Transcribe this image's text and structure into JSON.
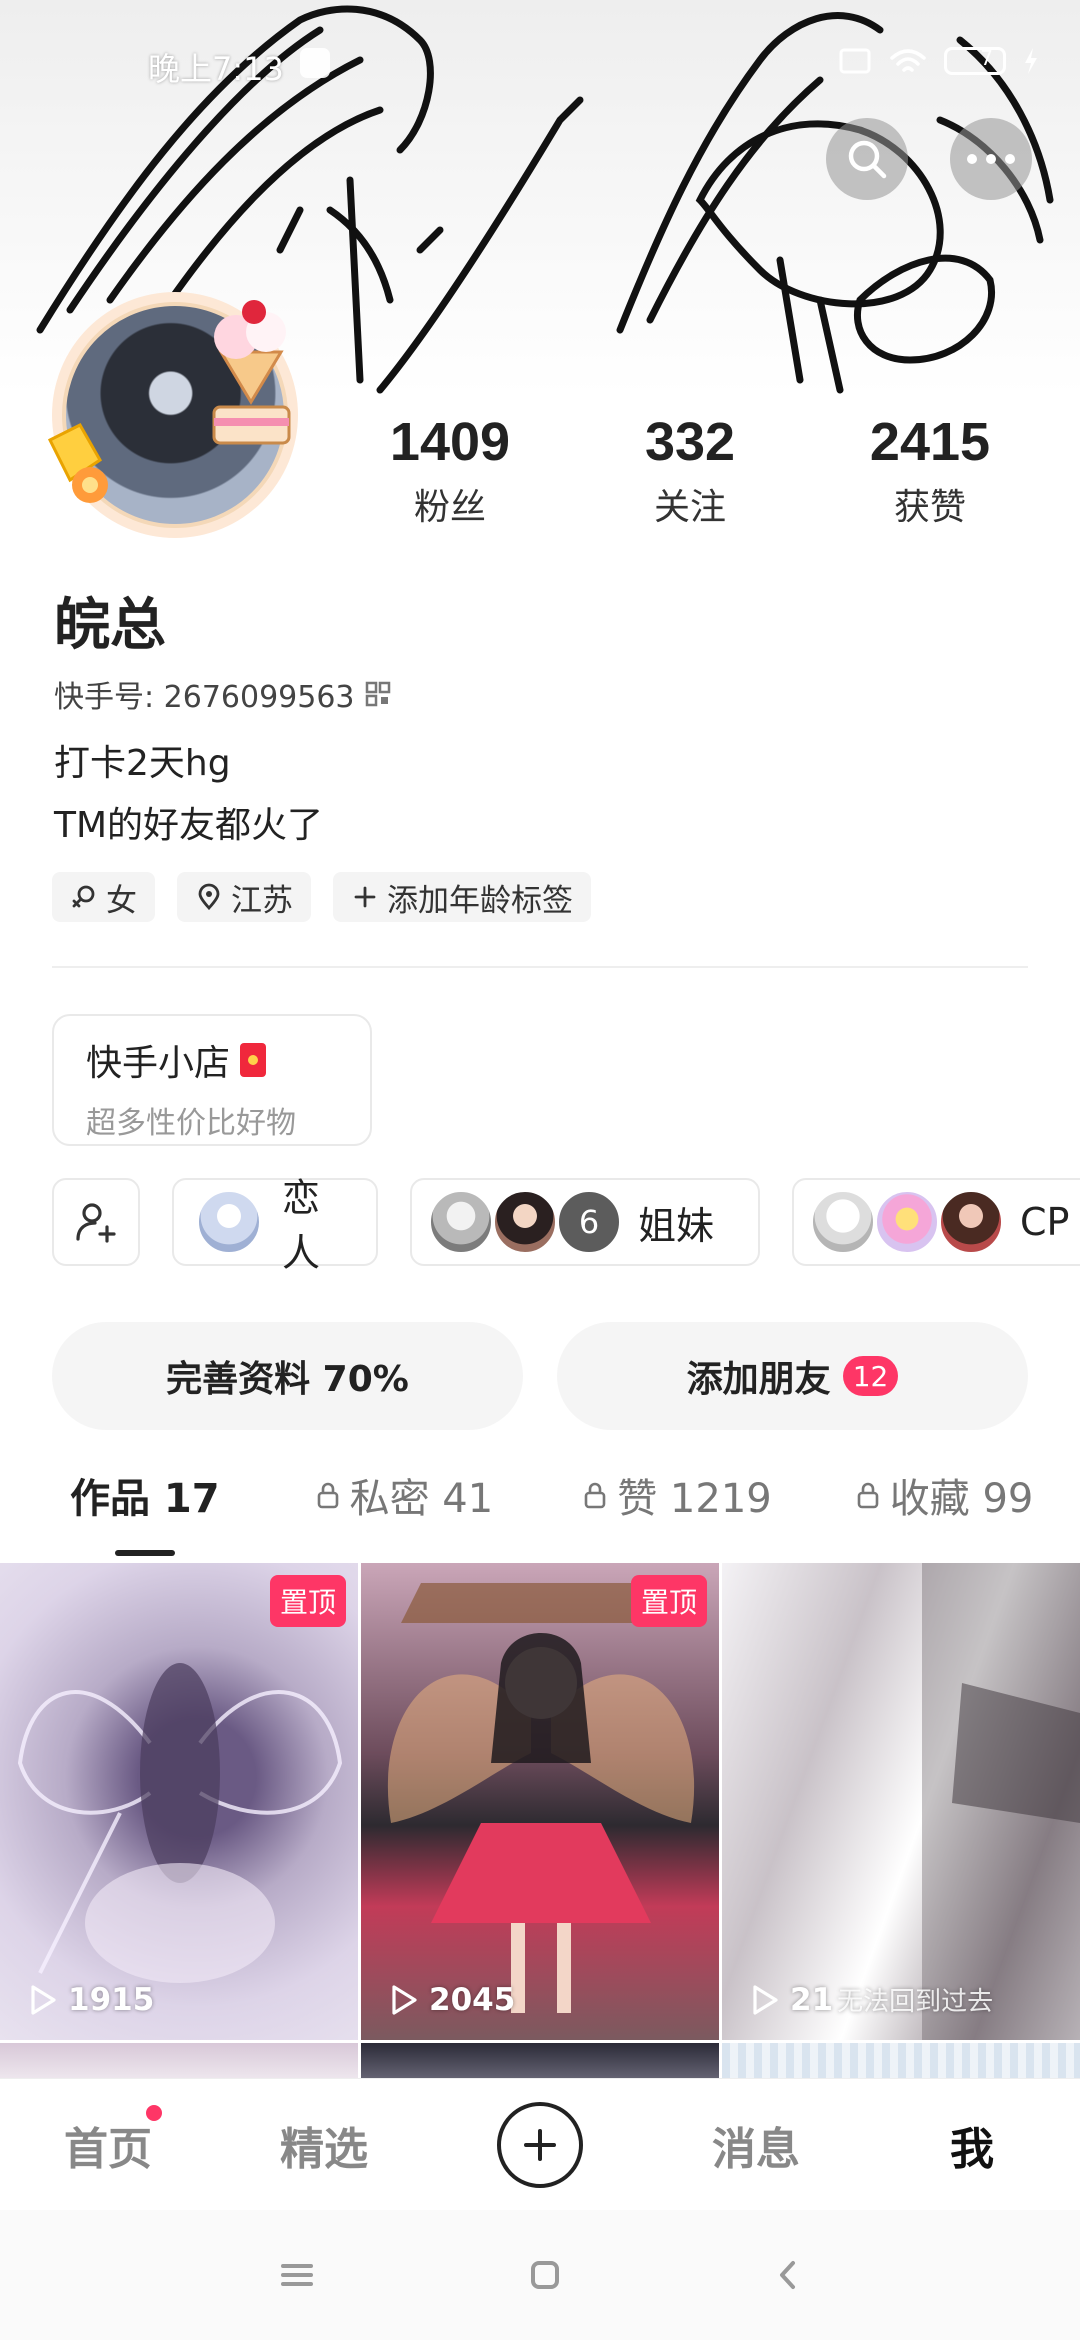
{
  "status_bar": {
    "time": "晚上7:13",
    "battery": "7"
  },
  "profile": {
    "followers": {
      "count": "1409",
      "label": "粉丝"
    },
    "following": {
      "count": "332",
      "label": "关注"
    },
    "likes": {
      "count": "2415",
      "label": "获赞"
    },
    "name": "皖总",
    "kuaishou_id": "快手号: 2676099563",
    "bio_line1": "打卡2天hg",
    "bio_line2": "TM的好友都火了",
    "tags": [
      "女",
      "江苏",
      "添加年龄标签"
    ]
  },
  "shop": {
    "title": "快手小店",
    "subtitle": "超多性价比好物"
  },
  "groups": [
    {
      "label": "恋人"
    },
    {
      "label": "姐妹",
      "count": "6"
    },
    {
      "label": "CP"
    }
  ],
  "actions": {
    "complete_profile": "完善资料 70%",
    "add_friends": "添加朋友",
    "add_friends_badge": "12"
  },
  "tabs": [
    {
      "label": "作品 17"
    },
    {
      "label": "私密 41"
    },
    {
      "label": "赞 1219"
    },
    {
      "label": "收藏 99"
    }
  ],
  "videos": [
    {
      "pinned_label": "置顶",
      "plays": "1915"
    },
    {
      "pinned_label": "置顶",
      "plays": "2045"
    },
    {
      "plays": "21",
      "watermark": "无法回到过去"
    }
  ],
  "bottom_nav": {
    "home": "首页",
    "featured": "精选",
    "messages": "消息",
    "me": "我"
  },
  "colors": {
    "accent": "#fe3666",
    "text": "#222222"
  }
}
